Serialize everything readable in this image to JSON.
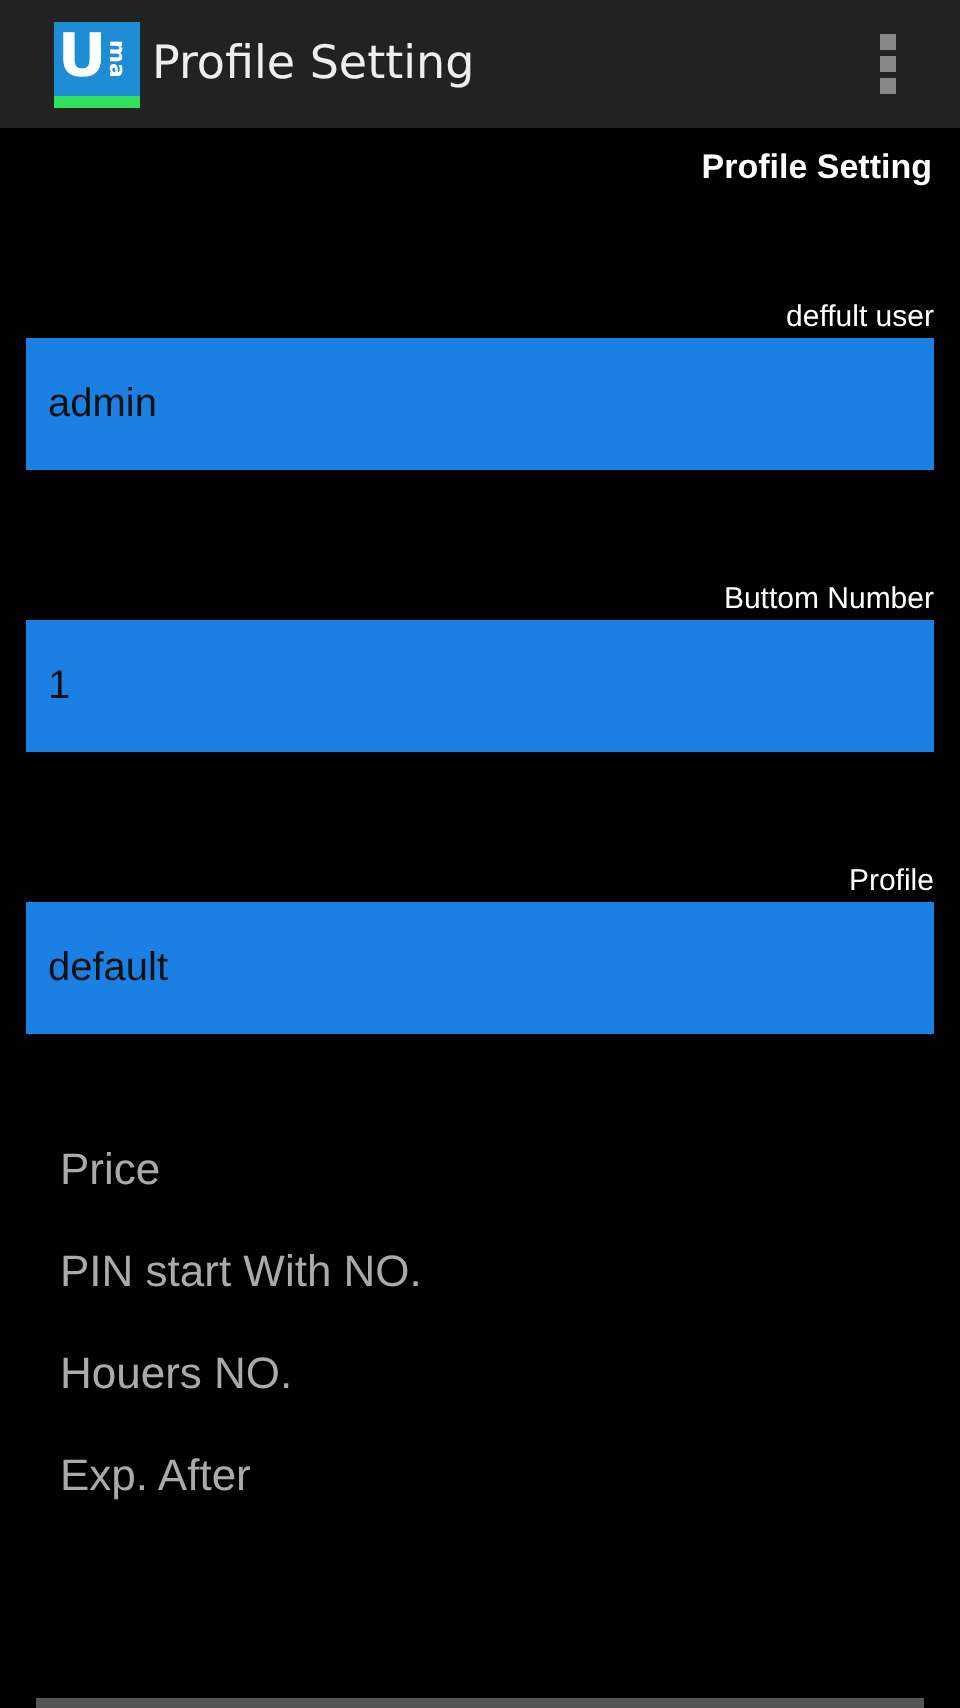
{
  "app_bar": {
    "logo": {
      "letter": "U",
      "side": "ma"
    },
    "title": "Profile Setting"
  },
  "section_title": "Profile Setting",
  "fields": [
    {
      "label": "deffult user",
      "value": "admin"
    },
    {
      "label": "Buttom Number",
      "value": "1"
    },
    {
      "label": "Profile",
      "value": "default"
    }
  ],
  "items": [
    "Price",
    "PIN start With NO.",
    "Houers NO.",
    "Exp. After"
  ]
}
